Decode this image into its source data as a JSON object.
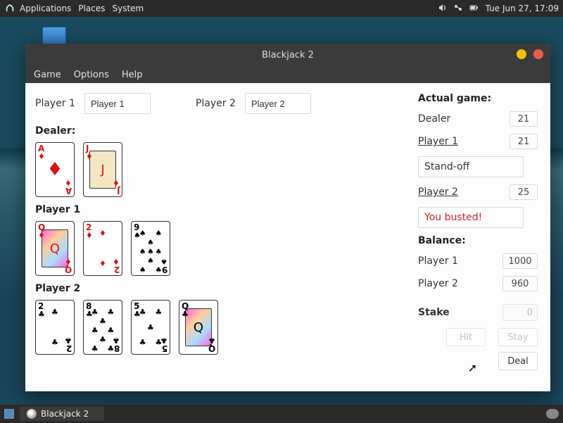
{
  "system": {
    "menus": {
      "applications": "Applications",
      "places": "Places",
      "system": "System"
    },
    "clock": "Tue Jun 27, 17:09",
    "icons": {
      "volume": "volume-icon",
      "net": "network-icon",
      "bat": "battery-icon"
    }
  },
  "taskbar": {
    "app_button_label": "Blackjack 2"
  },
  "window": {
    "title": "Blackjack 2",
    "menus": {
      "game": "Game",
      "options": "Options",
      "help": "Help"
    }
  },
  "players": {
    "p1_label": "Player 1",
    "p1_name": "Player 1",
    "p2_label": "Player 2",
    "p2_name": "Player 2"
  },
  "hands": {
    "dealer_label": "Dealer:",
    "p1_label": "Player 1",
    "p2_label": "Player 2",
    "dealer": [
      {
        "rank": "A",
        "suit": "♦",
        "color": "red",
        "layout": "ace"
      },
      {
        "rank": "J",
        "suit": "♦",
        "color": "red",
        "layout": "face"
      }
    ],
    "player1": [
      {
        "rank": "Q",
        "suit": "♦",
        "color": "red",
        "layout": "face"
      },
      {
        "rank": "2",
        "suit": "♦",
        "color": "red",
        "layout": "pips2"
      },
      {
        "rank": "9",
        "suit": "♠",
        "color": "blk",
        "layout": "pips9"
      }
    ],
    "player2": [
      {
        "rank": "2",
        "suit": "♣",
        "color": "blk",
        "layout": "pips2"
      },
      {
        "rank": "8",
        "suit": "♣",
        "color": "blk",
        "layout": "pips8"
      },
      {
        "rank": "5",
        "suit": "♣",
        "color": "blk",
        "layout": "pips5"
      },
      {
        "rank": "Q",
        "suit": "♣",
        "color": "blk",
        "layout": "face"
      }
    ]
  },
  "game": {
    "title": "Actual game:",
    "dealer_label": "Dealer",
    "dealer_value": "21",
    "p1_label": "Player 1",
    "p1_value": "21",
    "p1_status": "Stand-off",
    "p2_label": "Player 2",
    "p2_value": "25",
    "p2_status": "You busted!"
  },
  "balance": {
    "title": "Balance:",
    "p1_label": "Player 1",
    "p1_value": "1000",
    "p2_label": "Player 2",
    "p2_value": "960"
  },
  "stake": {
    "label": "Stake",
    "value": "0"
  },
  "buttons": {
    "hit": "Hit",
    "stay": "Stay",
    "deal": "Deal"
  }
}
